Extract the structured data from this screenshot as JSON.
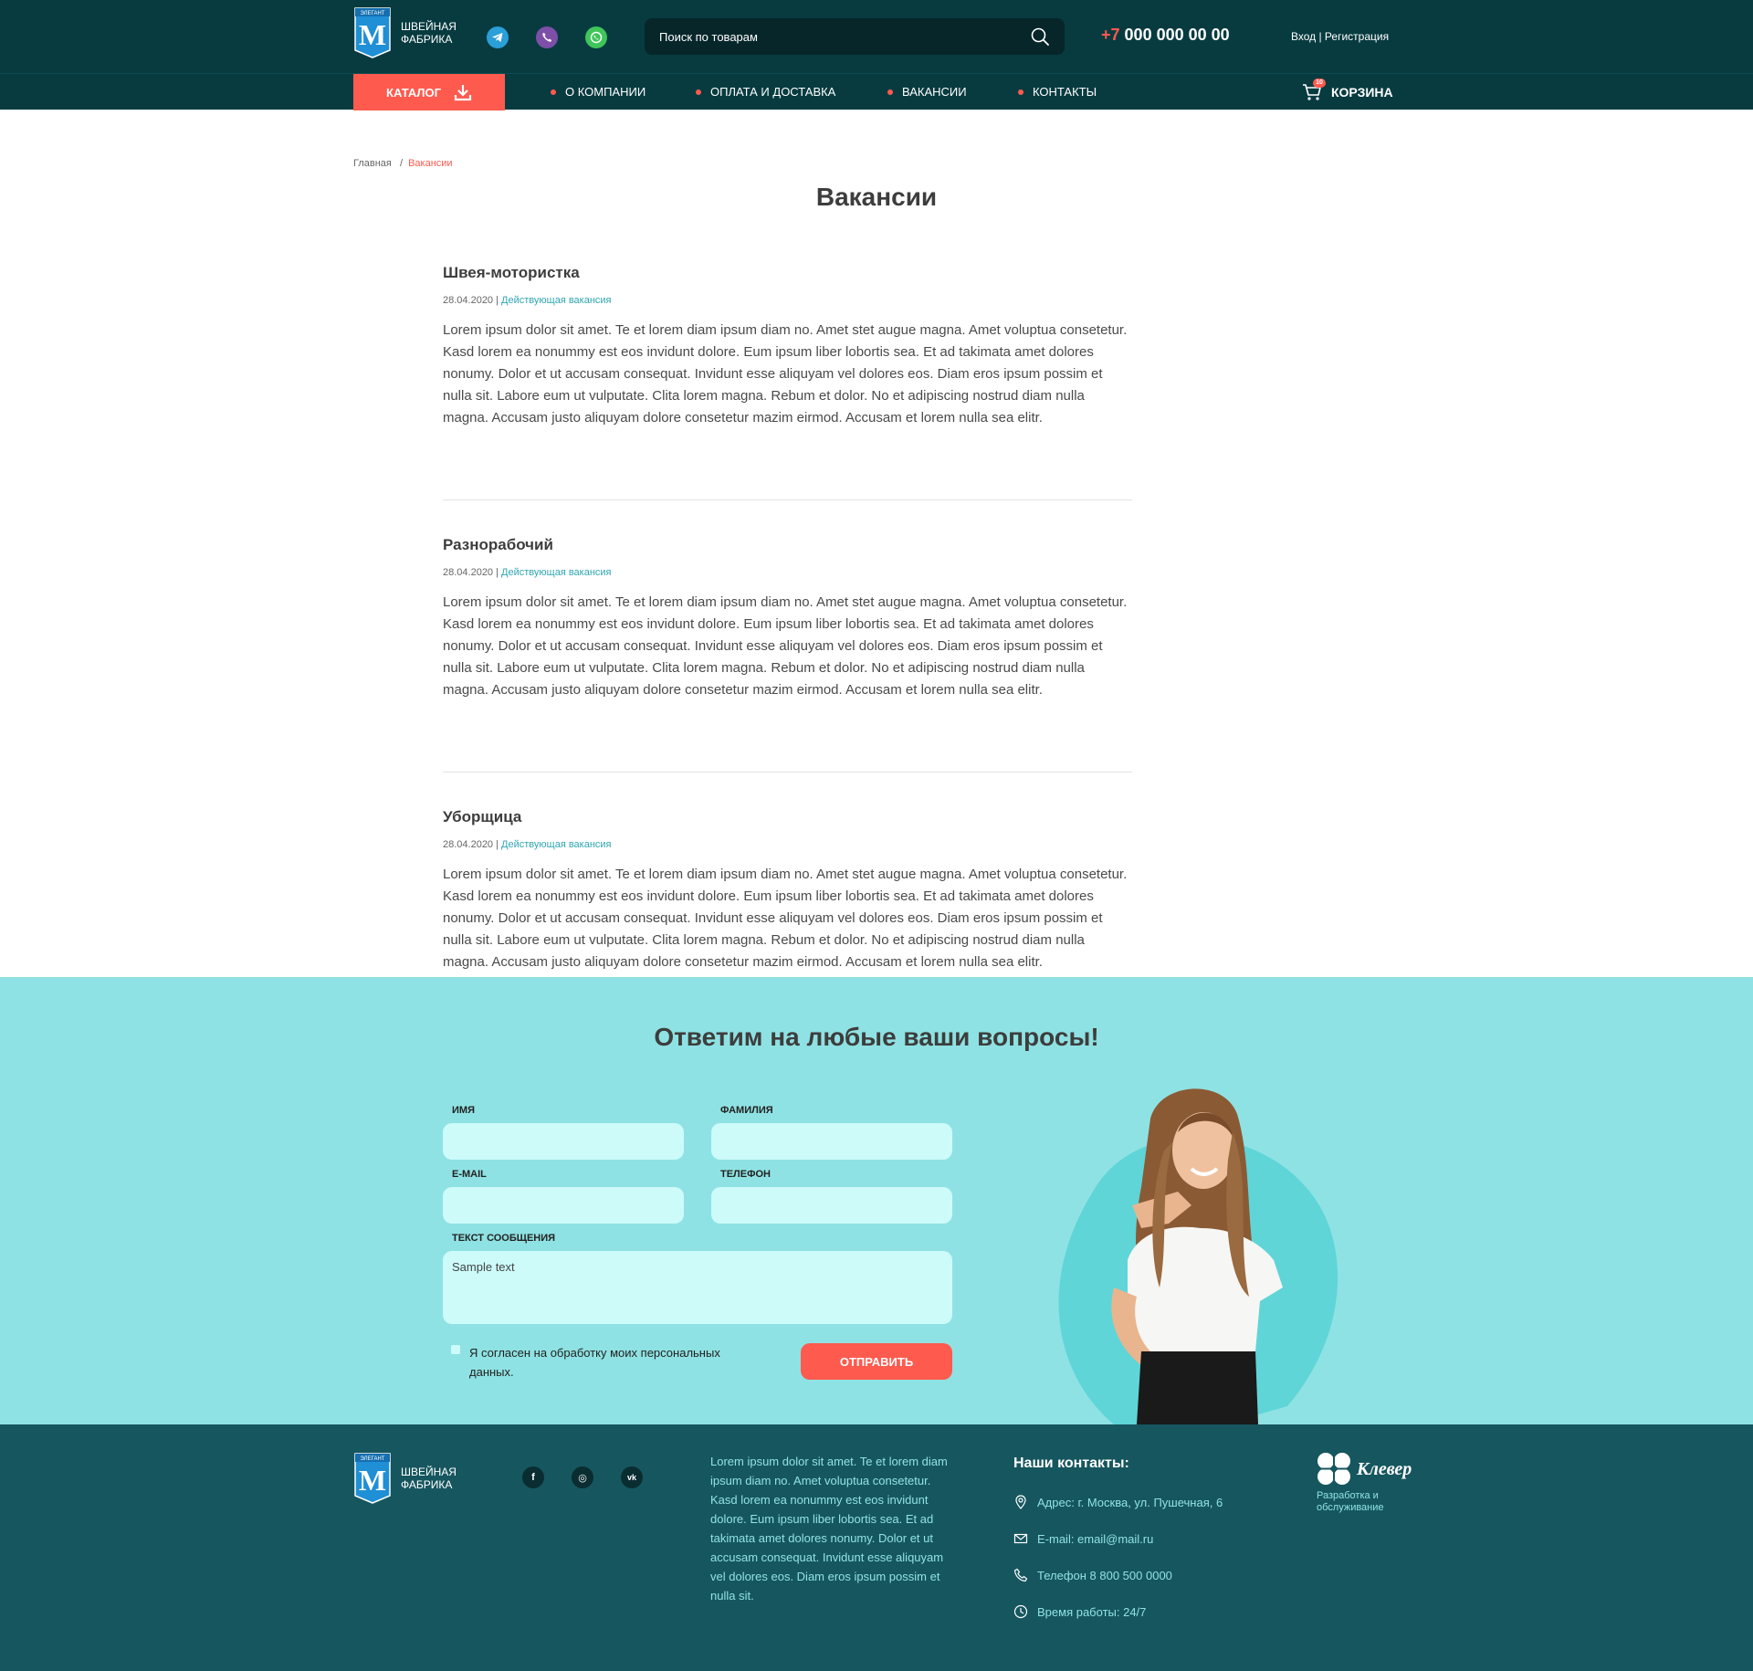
{
  "header": {
    "logo_line1": "Швейная",
    "logo_line2": "фабрика",
    "logo_emblem_text": "ЭЛЕГАНТ",
    "logo_letter": "М",
    "search_placeholder": "Поиск по товарам",
    "phone_prefix": "+7",
    "phone_number": "000 000 00 00",
    "auth": "Вход | Регистрация",
    "messengers": [
      "telegram-icon",
      "viber-icon",
      "whatsapp-icon"
    ]
  },
  "nav": {
    "catalog": "Каталог",
    "items": [
      "О компании",
      "Оплата и доставка",
      "Вакансии",
      "Контакты"
    ],
    "cart_label": "Корзина",
    "cart_count": "10"
  },
  "breadcrumb": {
    "home": "Главная",
    "separator": "/",
    "current": "Вакансии"
  },
  "page_title": "Вакансии",
  "vacancies": [
    {
      "title": "Швея-мотористка",
      "date": "28.04.2020",
      "separator": "|",
      "status": "Действующая вакансия",
      "description": "Lorem ipsum dolor sit amet. Te et lorem diam ipsum diam no. Amet stet augue magna. Amet voluptua consetetur. Kasd lorem ea nonummy est eos invidunt dolore. Eum ipsum liber lobortis sea. Et ad takimata amet dolores nonumy. Dolor et ut accusam consequat. Invidunt esse aliquyam vel dolores eos. Diam eros ipsum possim et nulla sit. Labore eum ut vulputate. Clita lorem magna. Rebum et dolor. No et adipiscing nostrud diam nulla magna. Accusam justo aliquyam dolore consetetur mazim eirmod. Accusam et lorem nulla sea elitr."
    },
    {
      "title": "Разнорабочий",
      "date": "28.04.2020",
      "separator": "|",
      "status": "Действующая вакансия",
      "description": "Lorem ipsum dolor sit amet. Te et lorem diam ipsum diam no. Amet stet augue magna. Amet voluptua consetetur. Kasd lorem ea nonummy est eos invidunt dolore. Eum ipsum liber lobortis sea. Et ad takimata amet dolores nonumy. Dolor et ut accusam consequat. Invidunt esse aliquyam vel dolores eos. Diam eros ipsum possim et nulla sit. Labore eum ut vulputate. Clita lorem magna. Rebum et dolor. No et adipiscing nostrud diam nulla magna. Accusam justo aliquyam dolore consetetur mazim eirmod. Accusam et lorem nulla sea elitr."
    },
    {
      "title": "Уборщица",
      "date": "28.04.2020",
      "separator": "|",
      "status": "Действующая вакансия",
      "description": "Lorem ipsum dolor sit amet. Te et lorem diam ipsum diam no. Amet stet augue magna. Amet voluptua consetetur. Kasd lorem ea nonummy est eos invidunt dolore. Eum ipsum liber lobortis sea. Et ad takimata amet dolores nonumy. Dolor et ut accusam consequat. Invidunt esse aliquyam vel dolores eos. Diam eros ipsum possim et nulla sit. Labore eum ut vulputate. Clita lorem magna. Rebum et dolor. No et adipiscing nostrud diam nulla magna. Accusam justo aliquyam dolore consetetur mazim eirmod. Accusam et lorem nulla sea elitr."
    }
  ],
  "contact_form": {
    "title": "Ответим на любые ваши вопросы!",
    "first_name_label": "Имя",
    "last_name_label": "Фамилия",
    "email_label": "E-mail",
    "phone_label": "Телефон",
    "message_label": "Текст сообщения",
    "message_placeholder": "Sample text",
    "consent": "Я согласен на обработку моих персональных данных.",
    "submit": "Отправить"
  },
  "footer": {
    "logo_line1": "Швейная",
    "logo_line2": "фабрика",
    "socials": [
      "facebook-icon",
      "instagram-icon",
      "vk-icon"
    ],
    "social_glyphs": [
      "f",
      "◎",
      "vk"
    ],
    "about": "Lorem ipsum dolor sit amet. Te et lorem diam ipsum diam no. Amet voluptua consetetur. Kasd lorem ea nonummy est eos invidunt dolore. Eum ipsum liber lobortis sea. Et ad takimata amet dolores nonumy. Dolor et ut accusam consequat. Invidunt esse aliquyam vel dolores eos. Diam eros ipsum possim et nulla sit.",
    "contacts_title": "Наши контакты:",
    "address": "Адрес: г. Москва, ул. Пушечная, 6",
    "email": "E-mail: email@mail.ru",
    "phone": "Телефон 8 800 500 0000",
    "hours": "Время работы: 24/7",
    "developer_name": "Клевер",
    "developer_caption": "Разработка и обслуживание"
  },
  "colors": {
    "header_bg": "#073b40",
    "accent": "#ff5a4e",
    "form_bg": "#8fe2e3",
    "field_bg": "#ccfbfa",
    "footer_bg": "#16565f",
    "status_link": "#2fa7b3"
  }
}
